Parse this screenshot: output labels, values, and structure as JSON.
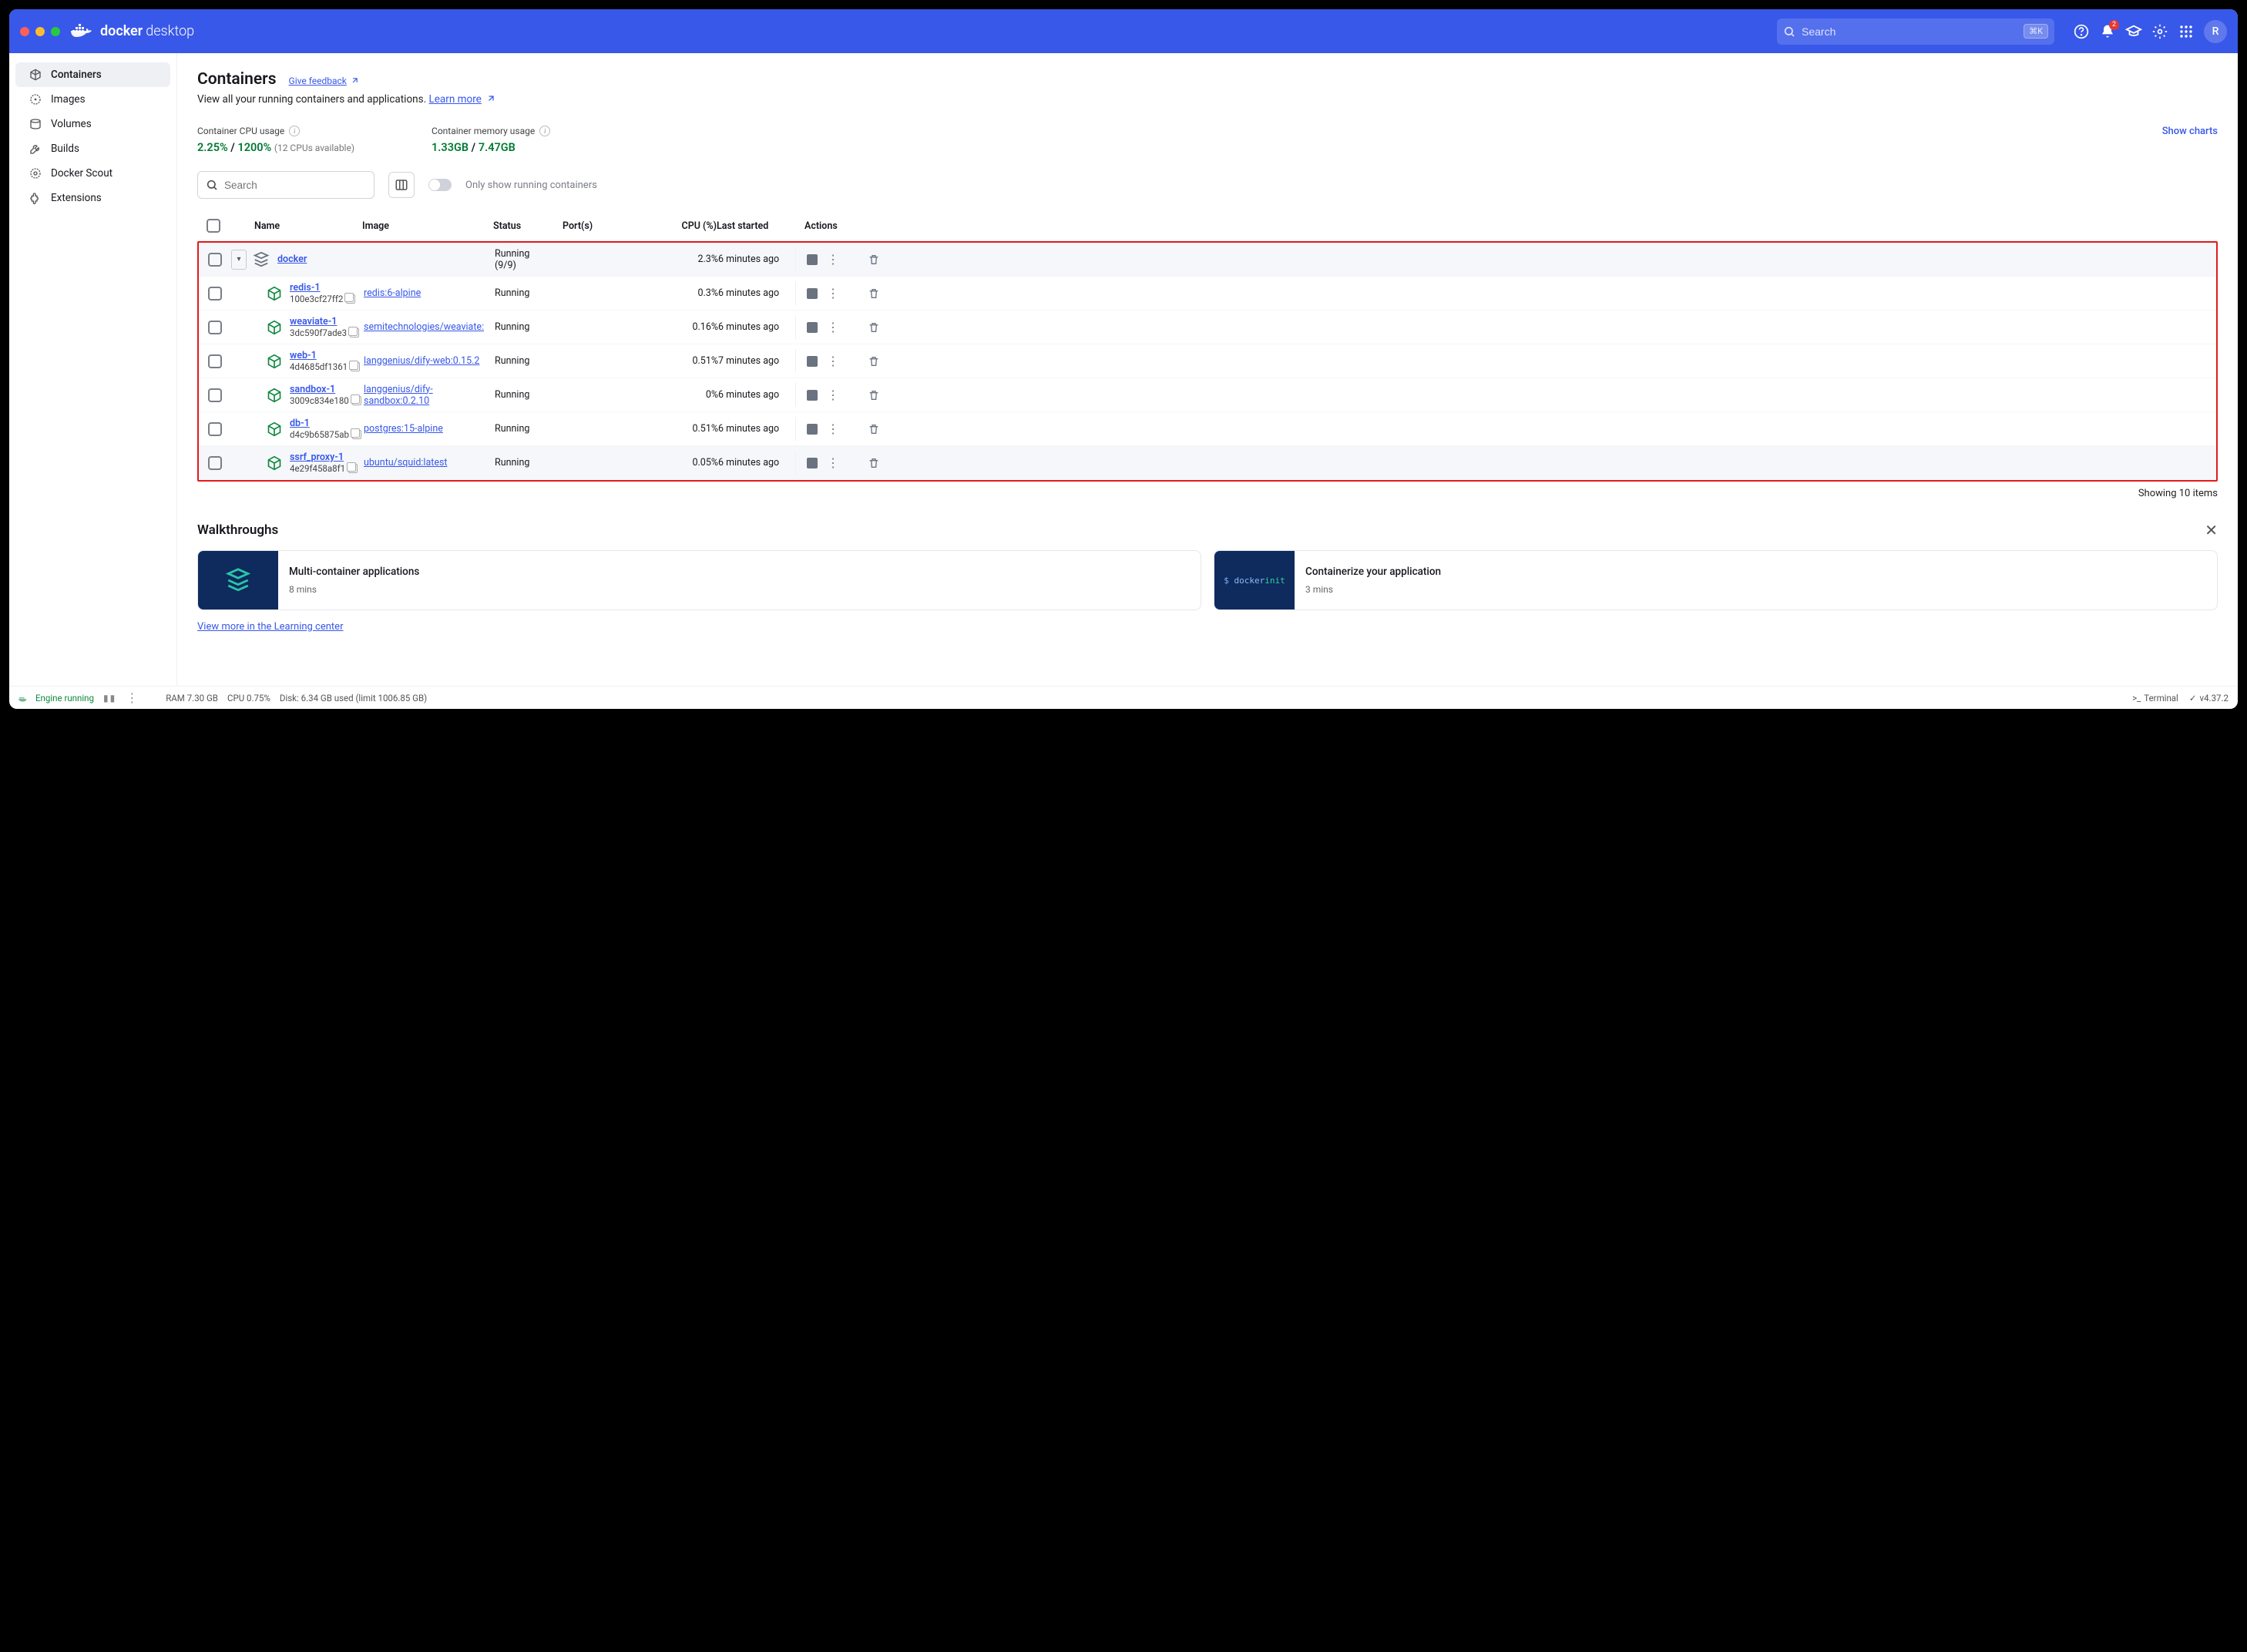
{
  "header": {
    "brand_bold": "docker",
    "brand_light": "desktop",
    "search_placeholder": "Search",
    "shortcut": "⌘K",
    "notification_count": "2",
    "avatar_initial": "R"
  },
  "sidebar": {
    "items": [
      {
        "label": "Containers",
        "icon": "container"
      },
      {
        "label": "Images",
        "icon": "image"
      },
      {
        "label": "Volumes",
        "icon": "volume"
      },
      {
        "label": "Builds",
        "icon": "build"
      },
      {
        "label": "Docker Scout",
        "icon": "scout"
      },
      {
        "label": "Extensions",
        "icon": "extension"
      }
    ]
  },
  "page": {
    "title": "Containers",
    "feedback": "Give feedback",
    "subtitle": "View all your running containers and applications.",
    "learn_more": "Learn more"
  },
  "stats": {
    "cpu_label": "Container CPU usage",
    "cpu_pct": "2.25%",
    "cpu_total": "1200%",
    "cpu_note": "(12 CPUs available)",
    "mem_label": "Container memory usage",
    "mem_used": "1.33GB",
    "mem_total": "7.47GB",
    "show_charts": "Show charts"
  },
  "controls": {
    "search_placeholder": "Search",
    "toggle_label": "Only show running containers"
  },
  "columns": {
    "name": "Name",
    "image": "Image",
    "status": "Status",
    "ports": "Port(s)",
    "cpu": "CPU (%)",
    "last": "Last started",
    "actions": "Actions"
  },
  "group": {
    "name": "docker",
    "status1": "Running",
    "status2": "(9/9)",
    "cpu": "2.3%",
    "last": "6 minutes ago"
  },
  "rows": [
    {
      "name": "redis-1",
      "hash": "100e3cf27ff2",
      "image": "redis:6-alpine",
      "status": "Running",
      "cpu": "0.3%",
      "last": "6 minutes ago"
    },
    {
      "name": "weaviate-1",
      "hash": "3dc590f7ade3",
      "image": "semitechnologies/weaviate:",
      "status": "Running",
      "cpu": "0.16%",
      "last": "6 minutes ago"
    },
    {
      "name": "web-1",
      "hash": "4d4685df1361",
      "image": "langgenius/dify-web:0.15.2",
      "status": "Running",
      "cpu": "0.51%",
      "last": "7 minutes ago"
    },
    {
      "name": "sandbox-1",
      "hash": "3009c834e180",
      "image": "langgenius/dify-sandbox:0.2.10",
      "status": "Running",
      "cpu": "0%",
      "last": "6 minutes ago"
    },
    {
      "name": "db-1",
      "hash": "d4c9b65875ab",
      "image": "postgres:15-alpine",
      "status": "Running",
      "cpu": "0.51%",
      "last": "6 minutes ago"
    },
    {
      "name": "ssrf_proxy-1",
      "hash": "4e29f458a8f1",
      "image": "ubuntu/squid:latest",
      "status": "Running",
      "cpu": "0.05%",
      "last": "6 minutes ago"
    }
  ],
  "showing": "Showing 10 items",
  "walkthroughs": {
    "title": "Walkthroughs",
    "cards": [
      {
        "title": "Multi-container applications",
        "mins": "8 mins",
        "thumb_type": "stack"
      },
      {
        "title": "Containerize your application",
        "mins": "3 mins",
        "thumb_type": "code",
        "thumb_text": "$ docker init"
      }
    ],
    "view_more": "View more in the Learning center"
  },
  "footer": {
    "engine": "Engine running",
    "ram": "RAM 7.30 GB",
    "cpu": "CPU 0.75%",
    "disk": "Disk: 6.34 GB used (limit 1006.85 GB)",
    "terminal": "Terminal",
    "version": "v4.37.2"
  }
}
